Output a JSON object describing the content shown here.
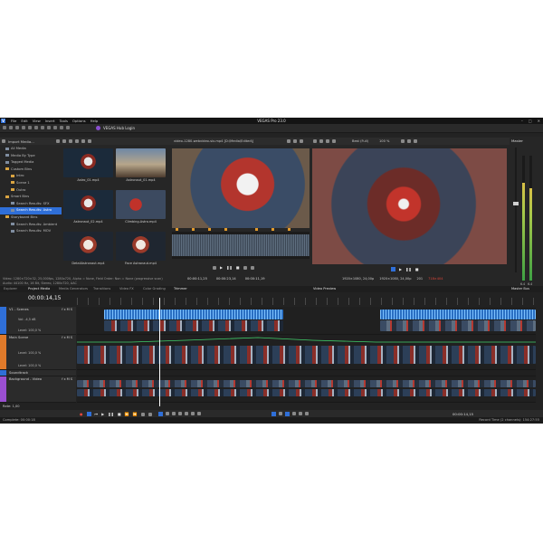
{
  "app": {
    "logo_letter": "V",
    "title": "VEGAS Pro 23.0",
    "menu": [
      "File",
      "Edit",
      "View",
      "Insert",
      "Tools",
      "Options",
      "Help"
    ],
    "hub_label": "VEGAS Hub Login",
    "window_controls": [
      "–",
      "□",
      "✕"
    ]
  },
  "media_panel": {
    "import_label": "Import Media...",
    "tree": [
      {
        "label": "All Media",
        "indent": 1,
        "folder": false,
        "selected": false
      },
      {
        "label": "Media By Type",
        "indent": 1,
        "folder": false,
        "selected": false
      },
      {
        "label": "Tagged Media",
        "indent": 1,
        "folder": false,
        "selected": false
      },
      {
        "label": "Custom Bins",
        "indent": 1,
        "folder": true,
        "selected": false
      },
      {
        "label": "Intro",
        "indent": 2,
        "folder": true,
        "selected": false
      },
      {
        "label": "Scene 1",
        "indent": 2,
        "folder": true,
        "selected": false
      },
      {
        "label": "Outro",
        "indent": 2,
        "folder": true,
        "selected": false
      },
      {
        "label": "Smart Bins",
        "indent": 1,
        "folder": true,
        "selected": false
      },
      {
        "label": "Search Results: SFX",
        "indent": 2,
        "folder": false,
        "selected": false
      },
      {
        "label": "Search Results: Astro",
        "indent": 2,
        "folder": false,
        "selected": true
      },
      {
        "label": "Storyboard Bins",
        "indent": 1,
        "folder": true,
        "selected": false
      },
      {
        "label": "Search Results: Ambient",
        "indent": 2,
        "folder": false,
        "selected": false
      },
      {
        "label": "Search Results: MOV",
        "indent": 2,
        "folder": false,
        "selected": false
      }
    ],
    "thumbnails": [
      {
        "name": "Astro_01.mp4",
        "style": "img-astro"
      },
      {
        "name": "Astronaut_01.mp4",
        "style": "img-desert"
      },
      {
        "name": "Astronaut_02.mp4",
        "style": "img-astro"
      },
      {
        "name": "Climbing-Astro.mp4",
        "style": "img-red"
      },
      {
        "name": "DetailAstronaut.mp4",
        "style": "img-face"
      },
      {
        "name": "Face Astronaut.mp4",
        "style": "img-face"
      }
    ],
    "meta_line1": "Video: 1280×720×32, 25,000fps, 1280x720, Alpha = None, Field Order: Non = None (progressive scan)",
    "meta_line2": "Audio: 44100 Hz, 16 Bit, Stereo, 1280x720, AAC"
  },
  "tabs": [
    "Explorer",
    "Project Media",
    "Media Generators",
    "Transitions",
    "Video FX",
    "Color Grading"
  ],
  "trimmer": {
    "file_label": "video-1280-webvideo-six.mp4 [D:\\Media\\Edited\\]",
    "tab_label": "Trimmer",
    "time_in": "00:00:11,25",
    "time_out": "00:00:23,14",
    "time_len": "00:00:11,19"
  },
  "preview": {
    "tab_label": "Video Preview",
    "quality": "Best (Full)",
    "zoom": "100 %",
    "project_res": "1920×1080, 24,00p",
    "preview_res": "1920×1080, 24,00p",
    "frame": "201",
    "display": "718×404"
  },
  "master": {
    "title": "Master",
    "tab_label": "Master Bus",
    "values": [
      "6.4",
      "6.4"
    ],
    "levels": [
      0.78,
      0.74
    ]
  },
  "timeline": {
    "time": "00:00:14,15",
    "tracks": [
      {
        "name": "V1 - Scenes",
        "color": "#2f6fd8",
        "level": "Level: 100,0 %",
        "vol": "Vol:  -4,5 dB"
      },
      {
        "name": "Main Scene",
        "color": "#e07a2a",
        "level": "Level: 100,0 %",
        "vol": "Level: 100,0 %"
      },
      {
        "name": "Soundtrack",
        "color": "#2f6fd8",
        "level": "",
        "vol": ""
      },
      {
        "name": "Background - Video",
        "color": "#9a4fd1",
        "level": "",
        "vol": ""
      }
    ],
    "rate": "Rate: 1,00"
  },
  "status": {
    "left": "Complete: 00:00:18",
    "right": "Record Time (2 channels): 154:27:55",
    "transport_time": "00:00:14,15"
  }
}
